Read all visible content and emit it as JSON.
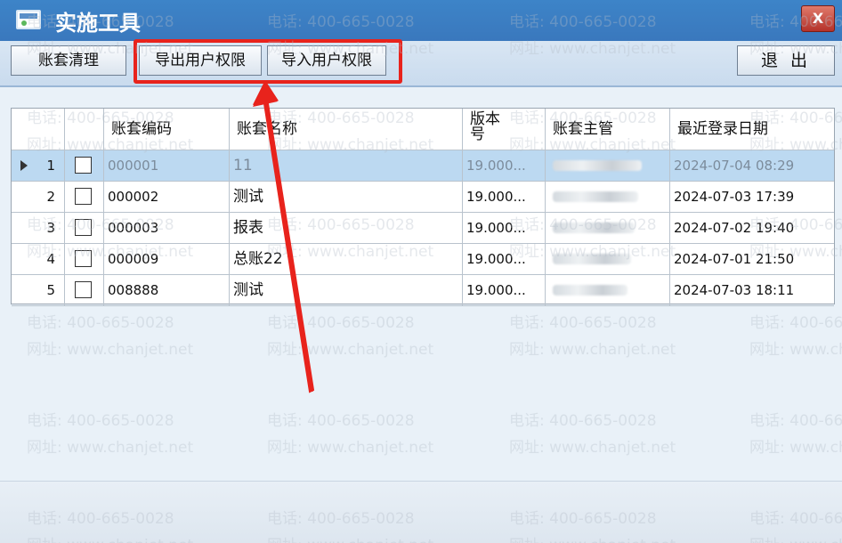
{
  "window": {
    "title": "实施工具",
    "close_label": "X"
  },
  "toolbar": {
    "clear_label": "账套清理",
    "export_label": "导出用户权限",
    "import_label": "导入用户权限",
    "exit_label": "退  出"
  },
  "table": {
    "columns": [
      "账套编码",
      "账套名称",
      "版本号",
      "账套主管",
      "最近登录日期"
    ],
    "rows": [
      {
        "num": "1",
        "code": "000001",
        "name": "11",
        "version": "19.000...",
        "date": "2024-07-04 08:29"
      },
      {
        "num": "2",
        "code": "000002",
        "name": "测试",
        "version": "19.000...",
        "date": "2024-07-03 17:39"
      },
      {
        "num": "3",
        "code": "000003",
        "name": "报表",
        "version": "19.000...",
        "date": "2024-07-02 19:40"
      },
      {
        "num": "4",
        "code": "000009",
        "name": "总账22",
        "version": "19.000...",
        "date": "2024-07-01 21:50"
      },
      {
        "num": "5",
        "code": "008888",
        "name": "测试",
        "version": "19.000...",
        "date": "2024-07-03 18:11"
      }
    ]
  },
  "watermark": {
    "phone": "电话: 400-665-0028",
    "site": "网址: www.chanjet.net"
  },
  "colors": {
    "titlebar": "#3d84c8",
    "selected_row": "#bcd9f1",
    "annotation": "#e8231c"
  }
}
